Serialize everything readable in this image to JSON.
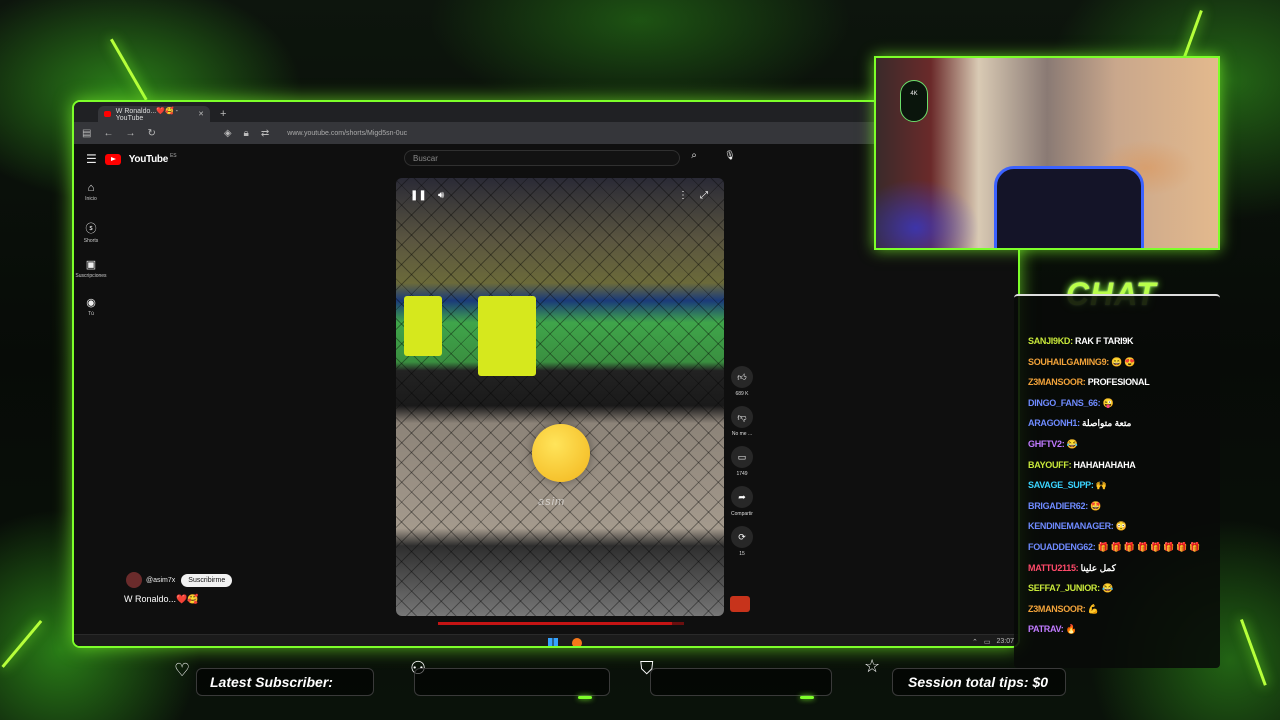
{
  "browser": {
    "tab_title": "W Ronaldo...❤️🥰 - YouTube",
    "new_tab": "+",
    "url": "www.youtube.com/shorts/Migd5sn-0uc"
  },
  "youtube": {
    "logo": "YouTube",
    "country": "ES",
    "search_placeholder": "Buscar",
    "sidebar": [
      {
        "label": "Inicio",
        "icon": "home-icon"
      },
      {
        "label": "Shorts",
        "icon": "shorts-icon"
      },
      {
        "label": "Suscripciones",
        "icon": "subscriptions-icon"
      },
      {
        "label": "Tú",
        "icon": "you-icon"
      }
    ],
    "video": {
      "watermark": "asim"
    },
    "actions": {
      "likes": "689 K",
      "dislike": "No me ...",
      "comments": "1749",
      "share": "Compartir",
      "remix": "15"
    },
    "channel": "@asim7x",
    "subscribe": "Suscribirme",
    "caption": "W Ronaldo...❤️🥰",
    "progress": 0.95
  },
  "taskbar": {
    "time": "23:07"
  },
  "chat": {
    "title": "CHAT",
    "messages": [
      {
        "user": "SANJI9KD:",
        "text": "RAK F TARI9K",
        "color": "#c8e83a"
      },
      {
        "user": "SOUHAILGAMING9:",
        "text": "😄 😍",
        "color": "#f2a33a"
      },
      {
        "user": "Z3MANSOOR:",
        "text": "PROFESIONAL",
        "color": "#f2a33a"
      },
      {
        "user": "DINGO_FANS_66:",
        "text": "😜",
        "color": "#6f8bff"
      },
      {
        "user": "ARAGONH1:",
        "text": "متعة متواصلة",
        "color": "#6f8bff"
      },
      {
        "user": "GHFTV2:",
        "text": "😂",
        "color": "#c07aff"
      },
      {
        "user": "BAYOUFF:",
        "text": "HAHAHAHAHA",
        "color": "#c8e83a"
      },
      {
        "user": "SAVAGE_SUPP:",
        "text": "🙌",
        "color": "#3ad4ff"
      },
      {
        "user": "BRIGADIER62:",
        "text": "🤩",
        "color": "#6f8bff"
      },
      {
        "user": "KENDINEMANAGER:",
        "text": "😳",
        "color": "#6f8bff"
      },
      {
        "user": "FOUADDENG62:",
        "text": "🎁 🎁 🎁 🎁 🎁 🎁 🎁 🎁",
        "color": "#6f8bff"
      },
      {
        "user": "MATTU2115:",
        "text": "كمل علينا",
        "color": "#ff4a6a"
      },
      {
        "user": "SEFFA7_JUNIOR:",
        "text": "😂",
        "color": "#c8e83a"
      },
      {
        "user": "Z3MANSOOR:",
        "text": "💪",
        "color": "#f2a33a"
      },
      {
        "user": "PATRAV:",
        "text": "🔥",
        "color": "#c07aff"
      }
    ]
  },
  "overlay": {
    "latest_subscriber": "Latest Subscriber:",
    "session_tips": "Session total tips: $0",
    "cam_badge": "4K"
  }
}
